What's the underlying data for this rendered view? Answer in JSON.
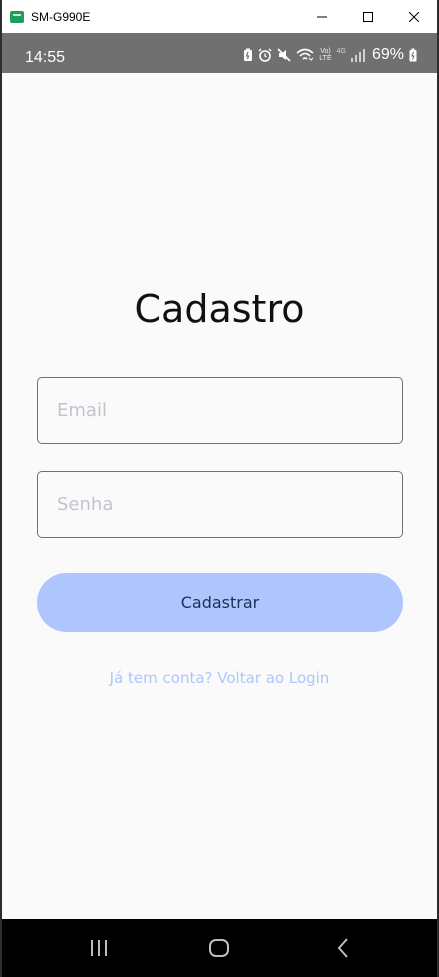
{
  "window": {
    "title": "SM-G990E"
  },
  "status_bar": {
    "time": "14:55",
    "battery_percent": "69%",
    "network_label_top": "Vo)",
    "network_label_bottom": "LTE",
    "network_type": "4G",
    "icons": [
      "battery-saver-icon",
      "alarm-icon",
      "mute-icon",
      "wifi-icon",
      "volte-icon",
      "signal-icon",
      "battery-icon"
    ]
  },
  "screen": {
    "title": "Cadastro",
    "email_placeholder": "Email",
    "password_placeholder": "Senha",
    "submit_label": "Cadastrar",
    "login_link": "Já tem conta? Voltar ao Login",
    "accent_color": "#aec6fd",
    "button_text_color": "#1d2e5c"
  },
  "nav_bar": {
    "icons": [
      "recents-icon",
      "home-icon",
      "back-icon"
    ]
  }
}
